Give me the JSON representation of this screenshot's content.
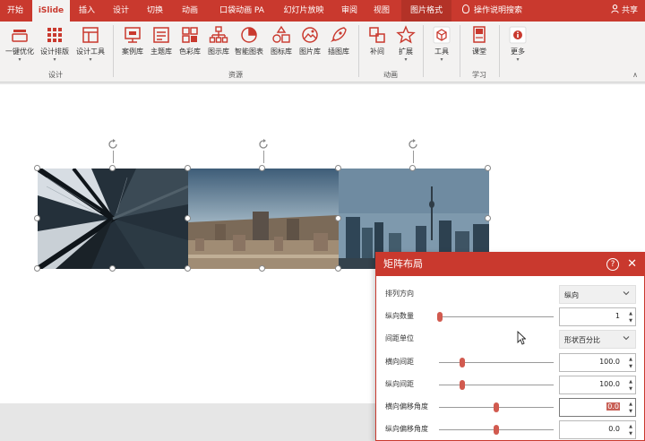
{
  "tabs": [
    {
      "label": "开始"
    },
    {
      "label": "iSlide"
    },
    {
      "label": "插入"
    },
    {
      "label": "设计"
    },
    {
      "label": "切换"
    },
    {
      "label": "动画"
    },
    {
      "label": "口袋动画 PA"
    },
    {
      "label": "幻灯片放映"
    },
    {
      "label": "审阅"
    },
    {
      "label": "视图"
    },
    {
      "label": "图片格式"
    }
  ],
  "tell_me": "操作说明搜索",
  "share": "共享",
  "ribbon": {
    "buttons": [
      {
        "label": "一键优化",
        "icon": "one-click-optimize-icon"
      },
      {
        "label": "设计排版",
        "icon": "design-layout-icon"
      },
      {
        "label": "设计工具",
        "icon": "design-tools-icon"
      },
      {
        "label": "案例库",
        "icon": "case-library-icon"
      },
      {
        "label": "主题库",
        "icon": "theme-library-icon"
      },
      {
        "label": "色彩库",
        "icon": "color-library-icon"
      },
      {
        "label": "图示库",
        "icon": "diagram-library-icon"
      },
      {
        "label": "智能图表",
        "icon": "smart-chart-icon"
      },
      {
        "label": "图标库",
        "icon": "icon-library-icon"
      },
      {
        "label": "图片库",
        "icon": "picture-library-icon"
      },
      {
        "label": "插图库",
        "icon": "illustration-library-icon"
      },
      {
        "label": "补间",
        "icon": "tween-icon"
      },
      {
        "label": "扩展",
        "icon": "extend-star-icon"
      },
      {
        "label": "工具",
        "icon": "tools-cube-icon"
      },
      {
        "label": "课堂",
        "icon": "classroom-book-icon"
      },
      {
        "label": "更多",
        "icon": "more-info-icon"
      }
    ],
    "groups": {
      "design": "设计",
      "resources": "资源",
      "animation": "动画",
      "learning": "学习"
    }
  },
  "dialog": {
    "title": "矩阵布局",
    "rows": [
      {
        "label": "排列方向",
        "value": "纵向"
      },
      {
        "label": "纵向数量",
        "value": "1"
      },
      {
        "label": "间距单位",
        "value": "形状百分比"
      },
      {
        "label": "横向间距",
        "value": "100.0"
      },
      {
        "label": "纵向间距",
        "value": "100.0"
      },
      {
        "label": "横向偏移角度",
        "value": "0.0"
      },
      {
        "label": "纵向偏移角度",
        "value": "0.0"
      }
    ]
  },
  "colors": {
    "accent": "#c9392e",
    "slider_knob": "#d15a4f"
  }
}
